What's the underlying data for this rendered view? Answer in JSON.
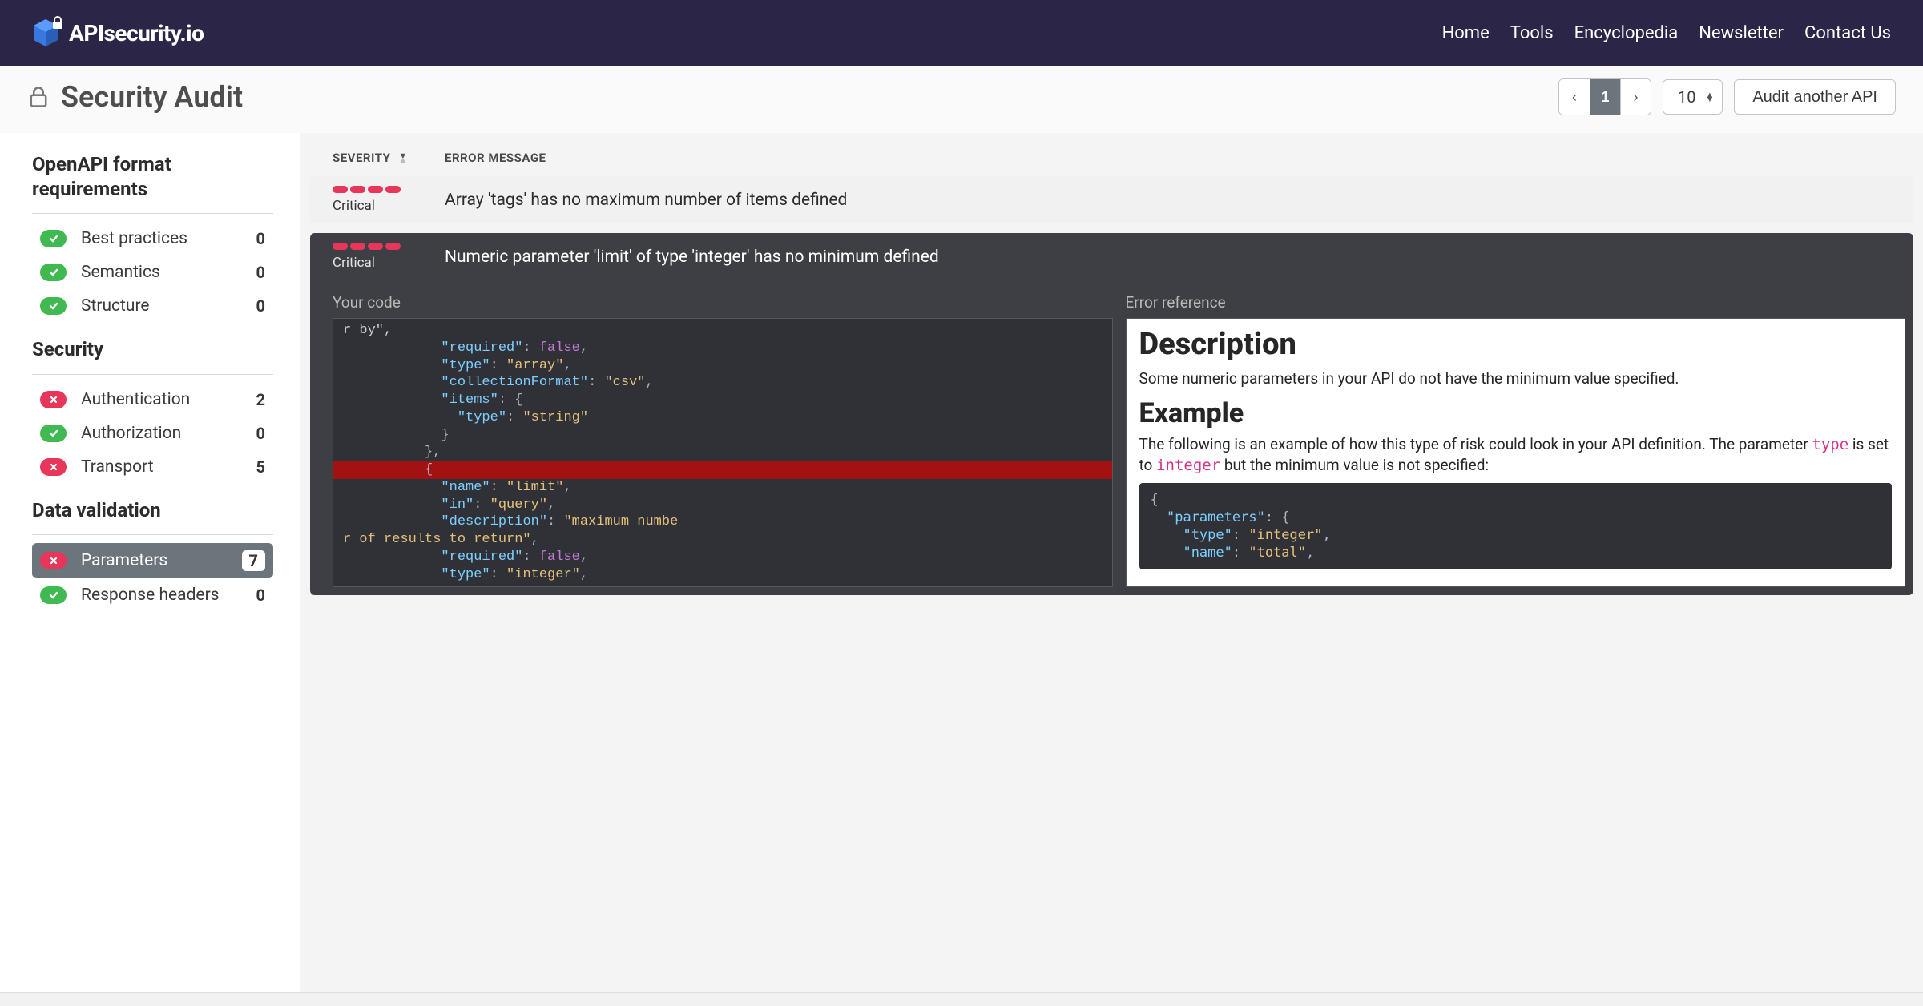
{
  "brand": {
    "name": "APIsecurity.io"
  },
  "nav": {
    "links": [
      "Home",
      "Tools",
      "Encyclopedia",
      "Newsletter",
      "Contact Us"
    ]
  },
  "page": {
    "title": "Security Audit",
    "pager": {
      "prev": "‹",
      "current": "1",
      "next": "›"
    },
    "page_size": "10",
    "audit_button": "Audit another API"
  },
  "sidebar": {
    "groups": [
      {
        "title": "OpenAPI format requirements",
        "items": [
          {
            "label": "Best practices",
            "status": "ok",
            "count": "0"
          },
          {
            "label": "Semantics",
            "status": "ok",
            "count": "0"
          },
          {
            "label": "Structure",
            "status": "ok",
            "count": "0"
          }
        ]
      },
      {
        "title": "Security",
        "items": [
          {
            "label": "Authentication",
            "status": "error",
            "count": "2"
          },
          {
            "label": "Authorization",
            "status": "ok",
            "count": "0"
          },
          {
            "label": "Transport",
            "status": "error",
            "count": "5"
          }
        ]
      },
      {
        "title": "Data validation",
        "items": [
          {
            "label": "Parameters",
            "status": "error",
            "count": "7",
            "selected": true
          },
          {
            "label": "Response headers",
            "status": "ok",
            "count": "0"
          }
        ]
      }
    ]
  },
  "table": {
    "headers": {
      "severity": "SEVERITY",
      "error": "ERROR MESSAGE"
    },
    "rows": [
      {
        "severity": "Critical",
        "pills": 4,
        "message": "Array 'tags' has no maximum number of items defined",
        "expanded": false
      },
      {
        "severity": "Critical",
        "pills": 4,
        "message": "Numeric parameter 'limit' of type 'integer' has no minimum defined",
        "expanded": true
      }
    ]
  },
  "detail": {
    "code_heading": "Your code",
    "ref_heading": "Error reference",
    "code_lines": [
      {
        "t": "r by\","
      },
      {
        "t": "            \"required\": false,",
        "tokens": [
          [
            "p",
            "            "
          ],
          [
            "k",
            "\"required\""
          ],
          [
            "p",
            ": "
          ],
          [
            "b",
            "false"
          ],
          [
            "p",
            ","
          ]
        ]
      },
      {
        "t": "            \"type\": \"array\",",
        "tokens": [
          [
            "p",
            "            "
          ],
          [
            "k",
            "\"type\""
          ],
          [
            "p",
            ": "
          ],
          [
            "s",
            "\"array\""
          ],
          [
            "p",
            ","
          ]
        ]
      },
      {
        "t": "            \"collectionFormat\": \"csv\",",
        "tokens": [
          [
            "p",
            "            "
          ],
          [
            "k",
            "\"collectionFormat\""
          ],
          [
            "p",
            ": "
          ],
          [
            "s",
            "\"csv\""
          ],
          [
            "p",
            ","
          ]
        ]
      },
      {
        "t": "            \"items\": {",
        "tokens": [
          [
            "p",
            "            "
          ],
          [
            "k",
            "\"items\""
          ],
          [
            "p",
            ": {"
          ]
        ]
      },
      {
        "t": "              \"type\": \"string\"",
        "tokens": [
          [
            "p",
            "              "
          ],
          [
            "k",
            "\"type\""
          ],
          [
            "p",
            ": "
          ],
          [
            "s",
            "\"string\""
          ]
        ]
      },
      {
        "t": "            }",
        "tokens": [
          [
            "p",
            "            }"
          ]
        ]
      },
      {
        "t": "          },",
        "tokens": [
          [
            "p",
            "          },"
          ]
        ]
      },
      {
        "t": "          {",
        "hl": true,
        "tokens": [
          [
            "p",
            "          {"
          ]
        ]
      },
      {
        "t": "            \"name\": \"limit\",",
        "tokens": [
          [
            "p",
            "            "
          ],
          [
            "k",
            "\"name\""
          ],
          [
            "p",
            ": "
          ],
          [
            "s",
            "\"limit\""
          ],
          [
            "p",
            ","
          ]
        ]
      },
      {
        "t": "            \"in\": \"query\",",
        "tokens": [
          [
            "p",
            "            "
          ],
          [
            "k",
            "\"in\""
          ],
          [
            "p",
            ": "
          ],
          [
            "s",
            "\"query\""
          ],
          [
            "p",
            ","
          ]
        ]
      },
      {
        "t": "            \"description\": \"maximum numbe",
        "tokens": [
          [
            "p",
            "            "
          ],
          [
            "k",
            "\"description\""
          ],
          [
            "p",
            ": "
          ],
          [
            "s",
            "\"maximum numbe"
          ]
        ]
      },
      {
        "t": "r of results to return\",",
        "tokens": [
          [
            "s",
            "r of results to return\""
          ],
          [
            "p",
            ","
          ]
        ]
      },
      {
        "t": "            \"required\": false,",
        "tokens": [
          [
            "p",
            "            "
          ],
          [
            "k",
            "\"required\""
          ],
          [
            "p",
            ": "
          ],
          [
            "b",
            "false"
          ],
          [
            "p",
            ","
          ]
        ]
      },
      {
        "t": "            \"type\": \"integer\",",
        "tokens": [
          [
            "p",
            "            "
          ],
          [
            "k",
            "\"type\""
          ],
          [
            "p",
            ": "
          ],
          [
            "s",
            "\"integer\""
          ],
          [
            "p",
            ","
          ]
        ]
      }
    ],
    "reference": {
      "h_desc": "Description",
      "p_desc": "Some numeric parameters in your API do not have the minimum value specified.",
      "h_ex": "Example",
      "p_ex_before": "The following is an example of how this type of risk could look in your API definition. The parameter ",
      "p_ex_code1": "type",
      "p_ex_mid": " is set to ",
      "p_ex_code2": "integer",
      "p_ex_after": " but the minimum value is not specified:",
      "ref_code_lines": [
        [
          [
            "p",
            "{"
          ]
        ],
        [
          [
            "p",
            "  "
          ],
          [
            "k",
            "\"parameters\""
          ],
          [
            "p",
            ": {"
          ]
        ],
        [
          [
            "p",
            "    "
          ],
          [
            "k",
            "\"type\""
          ],
          [
            "p",
            ": "
          ],
          [
            "s",
            "\"integer\""
          ],
          [
            "p",
            ","
          ]
        ],
        [
          [
            "p",
            "    "
          ],
          [
            "k",
            "\"name\""
          ],
          [
            "p",
            ": "
          ],
          [
            "s",
            "\"total\""
          ],
          [
            "p",
            ","
          ]
        ]
      ]
    }
  }
}
